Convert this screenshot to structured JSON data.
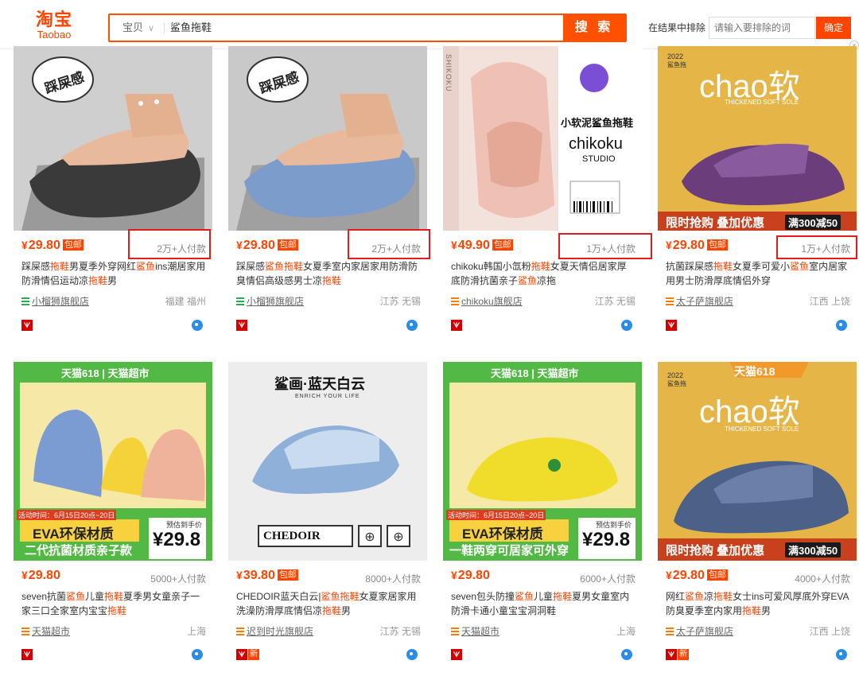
{
  "header": {
    "logo_cn": "淘宝",
    "logo_en": "Taobao",
    "search_category": "宝贝",
    "search_query": "鲨鱼拖鞋",
    "search_button": "搜 索",
    "exclude_label": "在结果中排除",
    "exclude_placeholder": "请输入要排除的词",
    "exclude_button": "确定",
    "close": "×"
  },
  "products": [
    {
      "price": "29.80",
      "baoyou": "包邮",
      "paid": "2万+人付款",
      "title_parts": [
        "踩屎感",
        "拖鞋",
        "男夏季外穿网红",
        "鲨鱼",
        "ins潮居家用防滑情侣运动凉",
        "拖鞋",
        "男"
      ],
      "shop": "小榴狮旗舰店",
      "location": "福建 福州",
      "image_text": "踩屎感"
    },
    {
      "price": "29.80",
      "baoyou": "包邮",
      "paid": "2万+人付款",
      "title_parts": [
        "踩屎感",
        "鲨鱼拖鞋",
        "女夏季室内家居家用防滑防臭情侣高级感男士凉",
        "拖鞋",
        ""
      ],
      "shop": "小榴狮旗舰店",
      "location": "江苏 无锡",
      "image_text": "踩屎感"
    },
    {
      "price": "49.90",
      "baoyou": "包邮",
      "paid": "1万+人付款",
      "title_parts": [
        "chikoku韩国小氙粉",
        "拖鞋",
        "女夏天情侣居家厚底防滑抗菌亲子",
        "鲨鱼",
        "凉拖"
      ],
      "shop": "chikoku旗舰店",
      "location": "江苏 无锡",
      "image_text_1": "小软泥鲨鱼拖鞋",
      "image_text_2": "chikoku",
      "image_text_3": "STUDIO",
      "image_text_4": "SHIKOKU"
    },
    {
      "price": "29.80",
      "baoyou": "包邮",
      "paid": "1万+人付款",
      "title_parts": [
        "抗菌踩屎感",
        "拖鞋",
        "女夏季可爱小",
        "鲨鱼",
        "室内居家用男士防滑厚底情侣外穿"
      ],
      "shop": "太子萨旗舰店",
      "location": "江西 上饶",
      "image_year": "2022",
      "image_brand": "鲨鱼拖",
      "image_headline": "chao软",
      "image_sub": "THICKENED SOFT SOLE",
      "image_promo": "限时抢购 叠加优惠",
      "image_deal": "满300减50"
    },
    {
      "price": "29.80",
      "baoyou": "",
      "paid": "5000+人付款",
      "title_parts": [
        "seven抗菌",
        "鲨鱼",
        "儿童",
        "拖鞋",
        "夏季男女童亲子一家三口全家室内宝宝",
        "拖鞋",
        ""
      ],
      "shop": "天猫超市",
      "location": "上海",
      "image_banner": "天猫618 | 天猫超市",
      "image_event": "活动时间：6月15日20点~20日",
      "image_material": "EVA环保材质",
      "image_presale": "预估到手价",
      "image_price": "¥29.8",
      "image_bottom": "二代抗菌材质亲子款"
    },
    {
      "price": "39.80",
      "baoyou": "包邮",
      "paid": "8000+人付款",
      "title_parts": [
        "CHEDOIR蓝天白云|",
        "鲨鱼拖鞋",
        "女夏家居家用洗澡防滑厚底情侣凉",
        "拖鞋",
        "男"
      ],
      "shop": "迟到时光旗舰店",
      "location": "江苏 无锡",
      "image_title": "鲨画·蓝天白云",
      "image_sub": "ENRICH YOUR LIFE",
      "image_brand": "CHEDOIR"
    },
    {
      "price": "29.80",
      "baoyou": "",
      "paid": "6000+人付款",
      "title_parts": [
        "seven包头防撞",
        "鲨鱼",
        "儿童",
        "拖鞋",
        "夏男女童室内防滑卡通小童宝宝洞洞鞋"
      ],
      "shop": "天猫超市",
      "location": "上海",
      "image_banner": "天猫618 | 天猫超市",
      "image_event": "活动时间：6月15日20点~20日",
      "image_material": "EVA环保材质",
      "image_presale": "预估到手价",
      "image_price": "¥29.8",
      "image_bottom": "一鞋两穿可居家可外穿"
    },
    {
      "price": "29.80",
      "baoyou": "包邮",
      "paid": "4000+人付款",
      "title_parts": [
        "网红",
        "鲨鱼",
        "凉",
        "拖鞋",
        "女士ins可爱风厚底外穿EVA防臭夏季室内家用",
        "拖鞋",
        "男"
      ],
      "shop": "太子萨旗舰店",
      "location": "江西 上饶",
      "image_banner": "天猫618",
      "image_year": "2022",
      "image_brand": "鲨鱼拖",
      "image_headline": "chao软",
      "image_sub": "THICKENED SOFT SOLE",
      "image_promo": "限时抢购 叠加优惠",
      "image_deal": "满300减50"
    }
  ],
  "badges": {
    "tmall": "天",
    "new": "新"
  },
  "colors": {
    "accent": "#ff4400",
    "search_border": "#ff5000",
    "highlight_box": "#e41b1b"
  }
}
